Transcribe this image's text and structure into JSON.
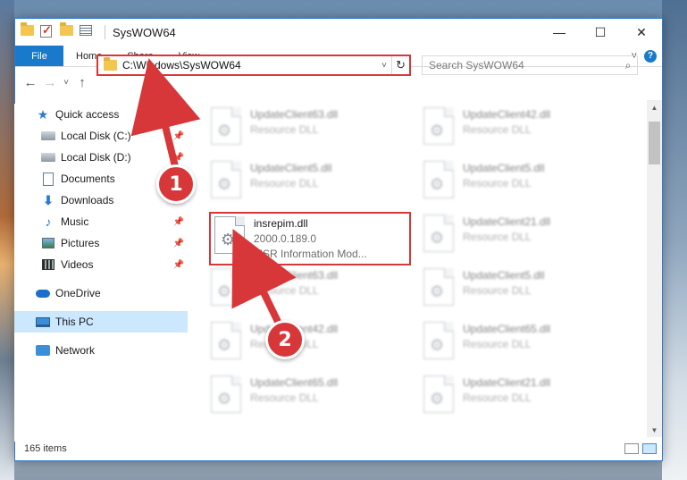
{
  "window": {
    "title": "SysWOW64",
    "minimize": "—",
    "maximize": "☐",
    "close": "✕"
  },
  "ribbon": {
    "tabs": [
      "File",
      "Home",
      "Share",
      "View"
    ],
    "expand": "˅",
    "help": "?"
  },
  "nav": {
    "back": "←",
    "forward": "→",
    "recent": "˅",
    "up": "↑",
    "address": "C:\\Windows\\SysWOW64",
    "address_dropdown": "˅",
    "refresh": "↻",
    "search_placeholder": "Search SysWOW64"
  },
  "sidebar": {
    "quick_access": "Quick access",
    "items": [
      {
        "label": "Local Disk (C:)",
        "icon": "disk-icon",
        "pinned": true
      },
      {
        "label": "Local Disk (D:)",
        "icon": "disk-icon",
        "pinned": true
      },
      {
        "label": "Documents",
        "icon": "documents-icon",
        "pinned": true
      },
      {
        "label": "Downloads",
        "icon": "downloads-icon",
        "pinned": true
      },
      {
        "label": "Music",
        "icon": "music-icon",
        "pinned": true
      },
      {
        "label": "Pictures",
        "icon": "pictures-icon",
        "pinned": true
      },
      {
        "label": "Videos",
        "icon": "videos-icon",
        "pinned": true
      }
    ],
    "onedrive": "OneDrive",
    "this_pc": "This PC",
    "network": "Network"
  },
  "files": [
    {
      "name": "UpdateClient63.dll",
      "meta": "Resource DLL"
    },
    {
      "name": "UpdateClient42.dll",
      "meta": "Resource DLL"
    },
    {
      "name": "UpdateClient5.dll",
      "meta": "Resource DLL"
    },
    {
      "name": "UpdateClient5.dll",
      "meta": "Resource DLL"
    },
    {
      "name": "insrepim.dll",
      "meta": "2000.0.189.0",
      "meta2": "MSR Information Mod..."
    },
    {
      "name": "UpdateClient21.dll",
      "meta": "Resource DLL"
    },
    {
      "name": "UpdateClient63.dll",
      "meta": "Resource DLL"
    },
    {
      "name": "UpdateClient5.dll",
      "meta": "Resource DLL"
    },
    {
      "name": "UpdateClient42.dll",
      "meta": "Resource DLL"
    },
    {
      "name": "UpdateClient65.dll",
      "meta": "Resource DLL"
    },
    {
      "name": "UpdateClient65.dll",
      "meta": "Resource DLL"
    },
    {
      "name": "UpdateClient21.dll",
      "meta": "Resource DLL"
    }
  ],
  "status": {
    "item_count": "165 items"
  },
  "callouts": {
    "one": "1",
    "two": "2"
  },
  "colors": {
    "accent": "#1979ca",
    "annotation_red": "#d8373a",
    "selected_bg": "#cce8ff"
  }
}
